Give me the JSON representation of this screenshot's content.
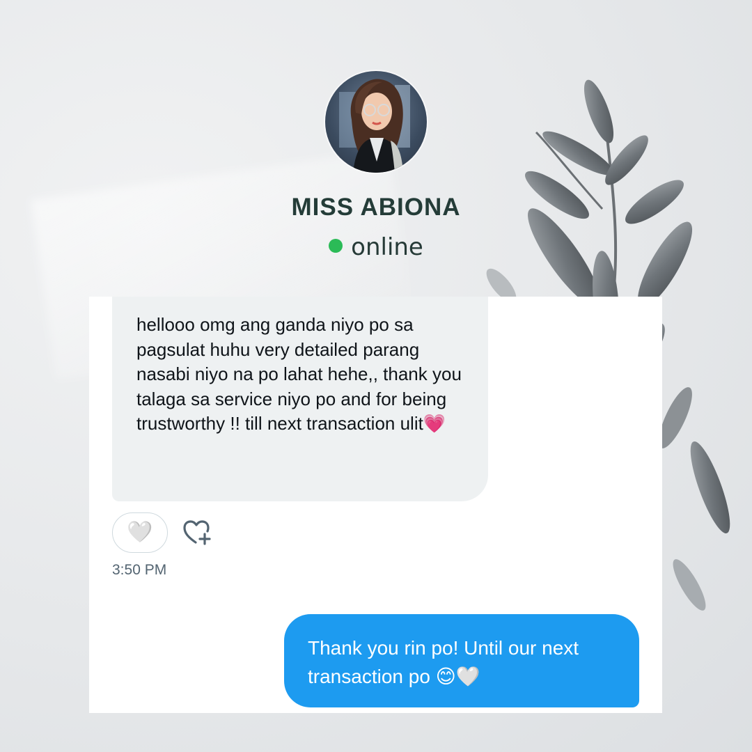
{
  "contact": {
    "name": "MISS ABIONA",
    "status": "online"
  },
  "messages": {
    "incoming": {
      "text": "hellooo omg ang ganda niyo po sa pagsulat huhu very detailed parang nasabi niyo na po lahat hehe,, thank you talaga sa service niyo po and for being trustworthy !! till next transaction ulit💗",
      "reaction": "🤍",
      "timestamp": "3:50 PM"
    },
    "outgoing": {
      "text": "Thank you rin po! Until our next transaction po 😊🤍"
    }
  },
  "icons": {
    "status_dot": "online-dot-icon",
    "add_reaction": "heart-plus-icon",
    "reaction": "white-heart-icon",
    "decoration": "eucalyptus-branch"
  },
  "colors": {
    "online": "#2bbb57",
    "name_text": "#243c38",
    "incoming_bubble": "#eef1f2",
    "outgoing_bubble": "#1d9bf0",
    "timestamp": "#536471"
  }
}
